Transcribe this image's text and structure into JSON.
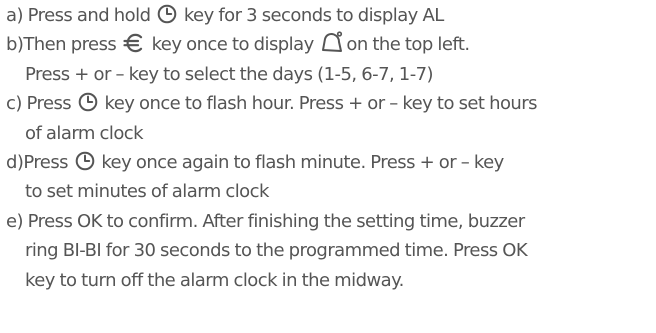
{
  "steps": {
    "a": {
      "label": "a)",
      "pre": "Press and hold",
      "icon": "clock-icon",
      "post": "key for 3 seconds to display AL"
    },
    "b": {
      "label": "b)",
      "pre": "Then press",
      "icon": "euro-icon",
      "mid": "key once to display",
      "icon2": "bell-icon",
      "post": "on the top left.",
      "line2": "Press + or – key to select the days (1-5, 6-7, 1-7)"
    },
    "c": {
      "label": "c)",
      "pre": "Press",
      "icon": "clock-icon",
      "post": "key once to flash hour. Press + or – key to set hours",
      "line2": "of alarm clock"
    },
    "d": {
      "label": "d)",
      "pre": "Press",
      "icon": "clock-icon",
      "post": "key once again to flash minute. Press + or – key",
      "line2": "to set minutes of alarm clock"
    },
    "e": {
      "label": "e)",
      "line1": "Press OK to confirm. After finishing the setting time, buzzer",
      "line2": "ring BI-BI for 30 seconds to the programmed time. Press OK",
      "line3": "key to turn off the alarm clock in the midway."
    }
  }
}
